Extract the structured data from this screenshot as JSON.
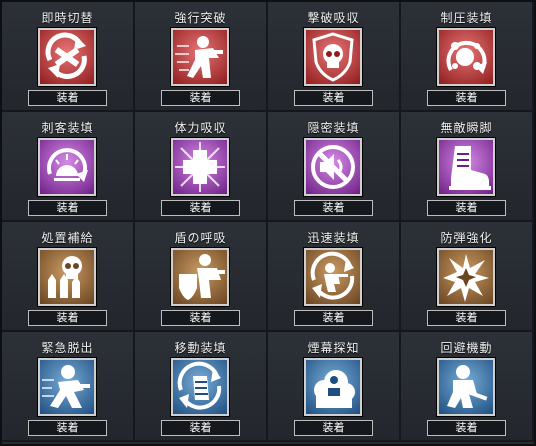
{
  "equip_label": "装着",
  "tier_colors": {
    "red": [
      "#e87575",
      "#8f1d1d"
    ],
    "purple": [
      "#d58ae6",
      "#6e1f86"
    ],
    "brown": [
      "#c99a62",
      "#6a4522"
    ],
    "blue": [
      "#79acd8",
      "#1e4f80"
    ]
  },
  "perks": [
    {
      "name": "即時切替",
      "tier": "red",
      "icon": "weapon-swap-icon"
    },
    {
      "name": "強行突破",
      "tier": "red",
      "icon": "charging-soldier-icon"
    },
    {
      "name": "撃破吸収",
      "tier": "red",
      "icon": "skull-shield-icon"
    },
    {
      "name": "制圧装填",
      "tier": "red",
      "icon": "explosion-reload-icon"
    },
    {
      "name": "刺客装填",
      "tier": "purple",
      "icon": "sunrise-reload-icon"
    },
    {
      "name": "体力吸収",
      "tier": "purple",
      "icon": "health-cross-icon"
    },
    {
      "name": "隠密装填",
      "tier": "purple",
      "icon": "muted-sound-icon"
    },
    {
      "name": "無敵瞬脚",
      "tier": "purple",
      "icon": "boot-icon"
    },
    {
      "name": "処置補給",
      "tier": "brown",
      "icon": "skull-ammo-icon"
    },
    {
      "name": "盾の呼吸",
      "tier": "brown",
      "icon": "soldier-shield-icon"
    },
    {
      "name": "迅速装填",
      "tier": "brown",
      "icon": "crouching-reload-icon"
    },
    {
      "name": "防弾強化",
      "tier": "brown",
      "icon": "impact-burst-icon"
    },
    {
      "name": "緊急脱出",
      "tier": "blue",
      "icon": "sprinting-soldier-icon"
    },
    {
      "name": "移動装填",
      "tier": "blue",
      "icon": "magazine-reload-icon"
    },
    {
      "name": "煙幕探知",
      "tier": "blue",
      "icon": "smoke-cloud-icon"
    },
    {
      "name": "回避機動",
      "tier": "blue",
      "icon": "crouching-rifleman-icon"
    }
  ]
}
